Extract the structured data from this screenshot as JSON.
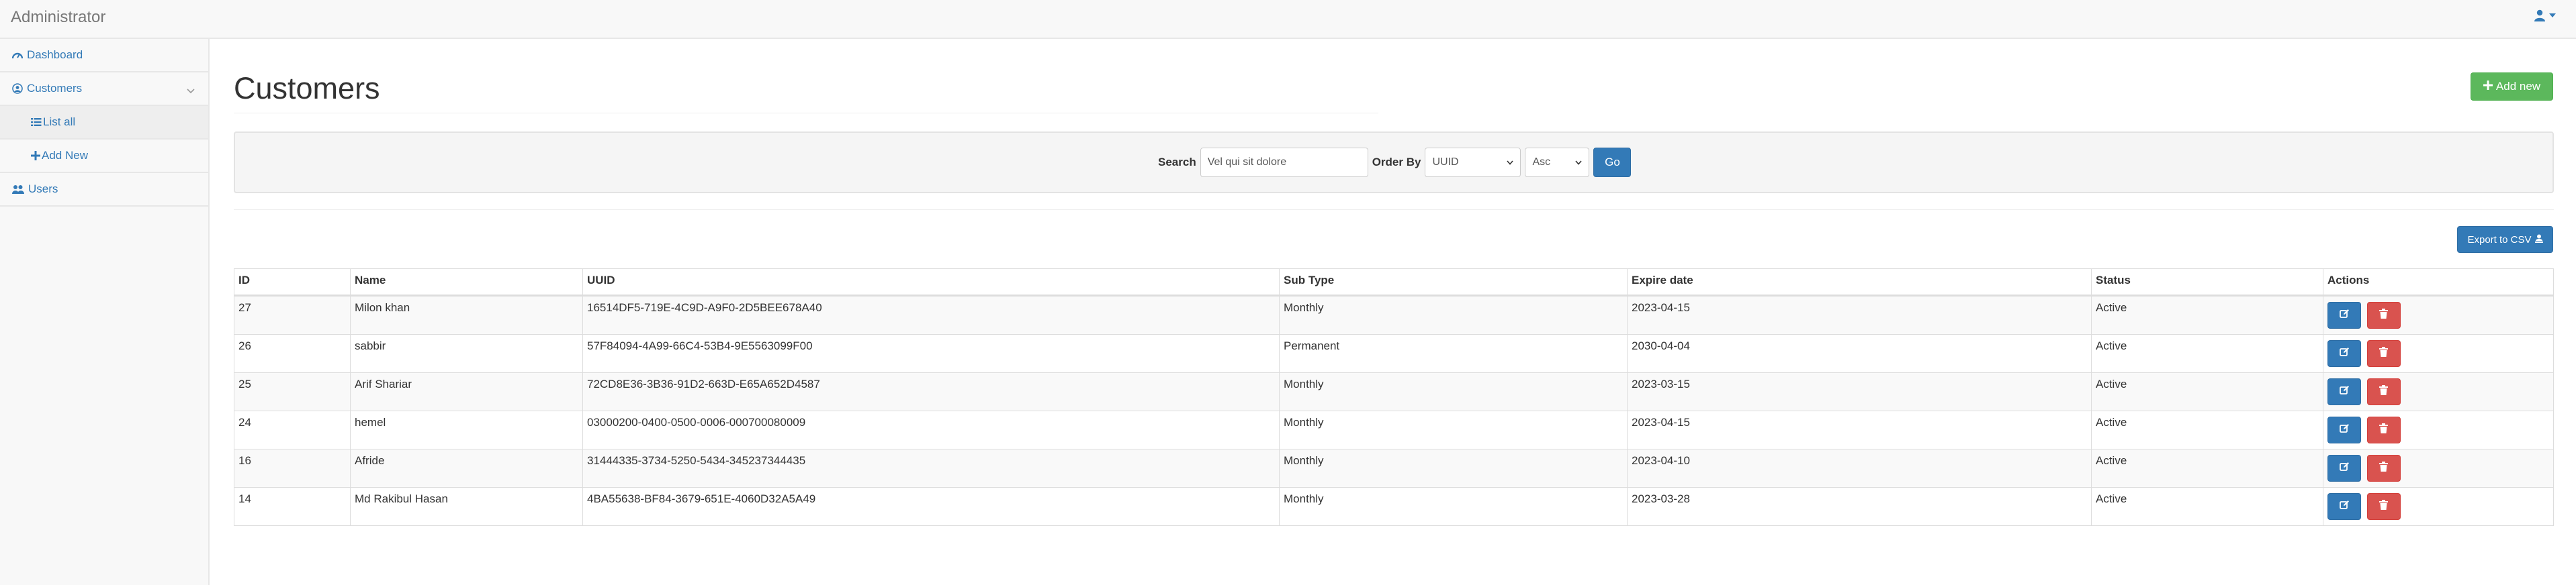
{
  "navbar": {
    "brand": "Administrator"
  },
  "sidebar": {
    "items": [
      {
        "label": "Dashboard",
        "icon": "dashboard-icon"
      },
      {
        "label": "Customers",
        "icon": "user-circle-icon"
      },
      {
        "label": "List all",
        "icon": "list-icon"
      },
      {
        "label": "Add New",
        "icon": "plus-icon"
      },
      {
        "label": "Users",
        "icon": "users-icon"
      }
    ]
  },
  "page": {
    "title": "Customers",
    "add_new_label": "Add new"
  },
  "search": {
    "label": "Search",
    "value": "Vel qui sit dolore",
    "order_by_label": "Order By",
    "order_by_value": "UUID",
    "direction_value": "Asc",
    "go_label": "Go"
  },
  "export_label": "Export to CSV",
  "table": {
    "headers": [
      "ID",
      "Name",
      "UUID",
      "Sub Type",
      "Expire date",
      "Status",
      "Actions"
    ],
    "rows": [
      {
        "id": "27",
        "name": "Milon khan",
        "uuid": "16514DF5-719E-4C9D-A9F0-2D5BEE678A40",
        "sub_type": "Monthly",
        "expire": "2023-04-15",
        "status": "Active"
      },
      {
        "id": "26",
        "name": "sabbir",
        "uuid": "57F84094-4A99-66C4-53B4-9E5563099F00",
        "sub_type": "Permanent",
        "expire": "2030-04-04",
        "status": "Active"
      },
      {
        "id": "25",
        "name": "Arif Shariar",
        "uuid": "72CD8E36-3B36-91D2-663D-E65A652D4587",
        "sub_type": "Monthly",
        "expire": "2023-03-15",
        "status": "Active"
      },
      {
        "id": "24",
        "name": "hemel",
        "uuid": "03000200-0400-0500-0006-000700080009",
        "sub_type": "Monthly",
        "expire": "2023-04-15",
        "status": "Active"
      },
      {
        "id": "16",
        "name": "Afride",
        "uuid": "31444335-3734-5250-5434-345237344435",
        "sub_type": "Monthly",
        "expire": "2023-04-10",
        "status": "Active"
      },
      {
        "id": "14",
        "name": "Md Rakibul Hasan",
        "uuid": "4BA55638-BF84-3679-651E-4060D32A5A49",
        "sub_type": "Monthly",
        "expire": "2023-03-28",
        "status": "Active"
      }
    ]
  },
  "colors": {
    "link": "#337ab7",
    "success": "#5cb85c",
    "primary": "#337ab7",
    "danger": "#d9534f"
  }
}
